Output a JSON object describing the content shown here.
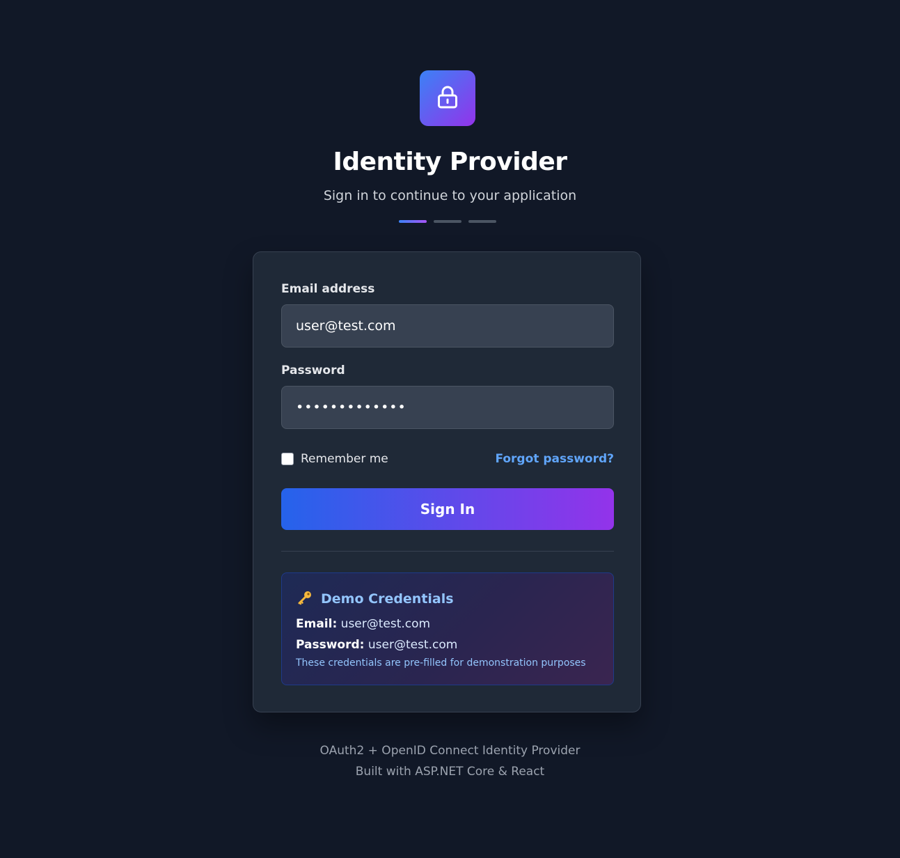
{
  "brand": {
    "icon": "lock-icon",
    "title": "Identity Provider",
    "subtitle": "Sign in to continue to your application"
  },
  "steps": {
    "count": 3,
    "active": 1
  },
  "form": {
    "email_label": "Email address",
    "email_value": "user@test.com",
    "password_label": "Password",
    "password_value": "•••••••••••••",
    "remember_label": "Remember me",
    "remember_checked": false,
    "forgot_label": "Forgot password?",
    "submit_label": "Sign In"
  },
  "demo": {
    "icon": "key-icon",
    "title": "Demo Credentials",
    "email_key": "Email:",
    "email_value": "user@test.com",
    "password_key": "Password:",
    "password_value": "user@test.com",
    "note": "These credentials are pre-filled for demonstration purposes"
  },
  "footer": {
    "line1": "OAuth2 + OpenID Connect Identity Provider",
    "line2": "Built with ASP.NET Core & React"
  },
  "colors": {
    "background": "#111827",
    "card": "#1f2937",
    "accent_start": "#2563eb",
    "accent_end": "#9333ea",
    "link": "#60a5fa"
  }
}
